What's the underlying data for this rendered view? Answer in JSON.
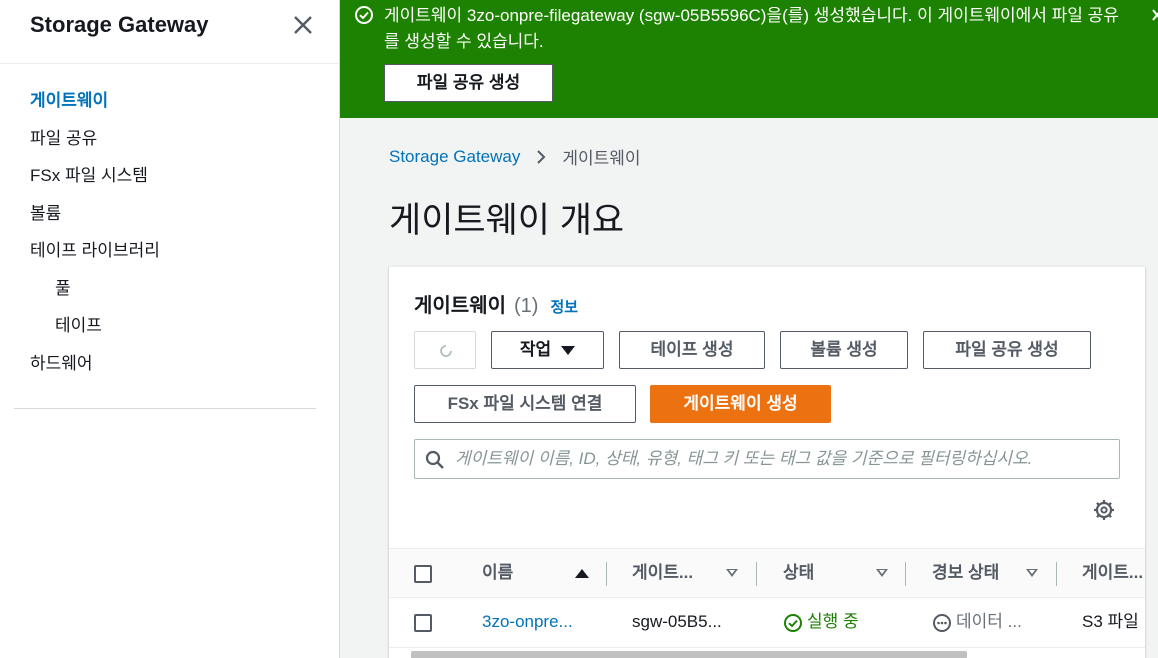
{
  "sidebar": {
    "title": "Storage Gateway",
    "items": [
      {
        "label": "게이트웨이"
      },
      {
        "label": "파일 공유"
      },
      {
        "label": "FSx 파일 시스템"
      },
      {
        "label": "볼륨"
      },
      {
        "label": "테이프 라이브러리"
      },
      {
        "label": "풀"
      },
      {
        "label": "테이프"
      },
      {
        "label": "하드웨어"
      }
    ]
  },
  "flash": {
    "message": "게이트웨이 3zo-onpre-filegateway (sgw-05B5596C)을(를) 생성했습니다. 이 게이트웨이에서 파일 공유를 생성할 수 있습니다.",
    "button": "파일 공유 생성",
    "color": "#1d8102"
  },
  "breadcrumb": {
    "root": "Storage Gateway",
    "current": "게이트웨이"
  },
  "page_title": "게이트웨이 개요",
  "panel": {
    "title": "게이트웨이",
    "count": "(1)",
    "info": "정보",
    "buttons": {
      "actions": "작업",
      "create_tape": "테이프 생성",
      "create_volume": "볼륨 생성",
      "create_file_share": "파일 공유 생성",
      "attach_fsx": "FSx 파일 시스템 연결",
      "create_gateway": "게이트웨이 생성"
    },
    "search_placeholder": "게이트웨이 이름, ID, 상태, 유형, 태그 키 또는 태그 값을 기준으로 필터링하십시오.",
    "accent": "#ec7211"
  },
  "table": {
    "columns": [
      "이름",
      "게이트...",
      "상태",
      "경보 상태",
      "게이트..."
    ],
    "rows": [
      {
        "name": "3zo-onpre...",
        "id": "sgw-05B5...",
        "status": "실행 중",
        "alarm": "데이터 ...",
        "type": "S3 파일"
      }
    ]
  }
}
